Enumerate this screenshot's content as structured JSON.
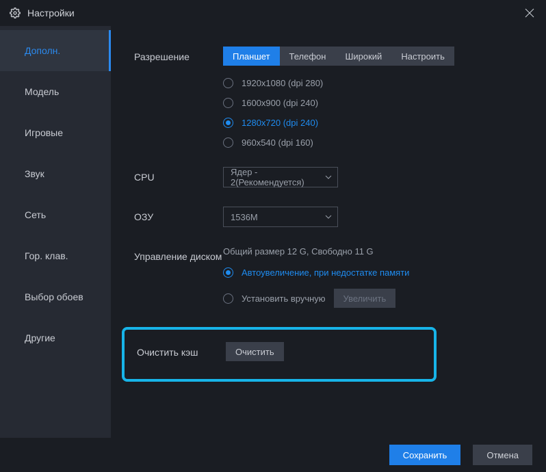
{
  "window": {
    "title": "Настройки"
  },
  "sidebar": {
    "items": [
      {
        "label": "Дополн.",
        "active": true
      },
      {
        "label": "Модель",
        "active": false
      },
      {
        "label": "Игровые",
        "active": false
      },
      {
        "label": "Звук",
        "active": false
      },
      {
        "label": "Сеть",
        "active": false
      },
      {
        "label": "Гор. клав.",
        "active": false
      },
      {
        "label": "Выбор обоев",
        "active": false
      },
      {
        "label": "Другие",
        "active": false
      }
    ]
  },
  "resolution": {
    "label": "Разрешение",
    "tabs": [
      {
        "label": "Планшет",
        "active": true
      },
      {
        "label": "Телефон",
        "active": false
      },
      {
        "label": "Широкий",
        "active": false
      },
      {
        "label": "Настроить",
        "active": false
      }
    ],
    "options": [
      {
        "label": "1920x1080  (dpi 280)",
        "checked": false
      },
      {
        "label": "1600x900  (dpi 240)",
        "checked": false
      },
      {
        "label": "1280x720  (dpi 240)",
        "checked": true
      },
      {
        "label": "960x540  (dpi 160)",
        "checked": false
      }
    ]
  },
  "cpu": {
    "label": "CPU",
    "value": "Ядер - 2(Рекомендуется)"
  },
  "ram": {
    "label": "ОЗУ",
    "value": "1536M"
  },
  "disk": {
    "label": "Управление диском",
    "status": "Общий размер 12 G,  Свободно 11 G",
    "opt_auto": "Автоувеличение, при недостатке памяти",
    "opt_manual": "Установить вручную",
    "expand_btn": "Увеличить"
  },
  "cache": {
    "label": "Очистить кэш",
    "button": "Очистить"
  },
  "footer": {
    "save": "Сохранить",
    "cancel": "Отмена"
  }
}
